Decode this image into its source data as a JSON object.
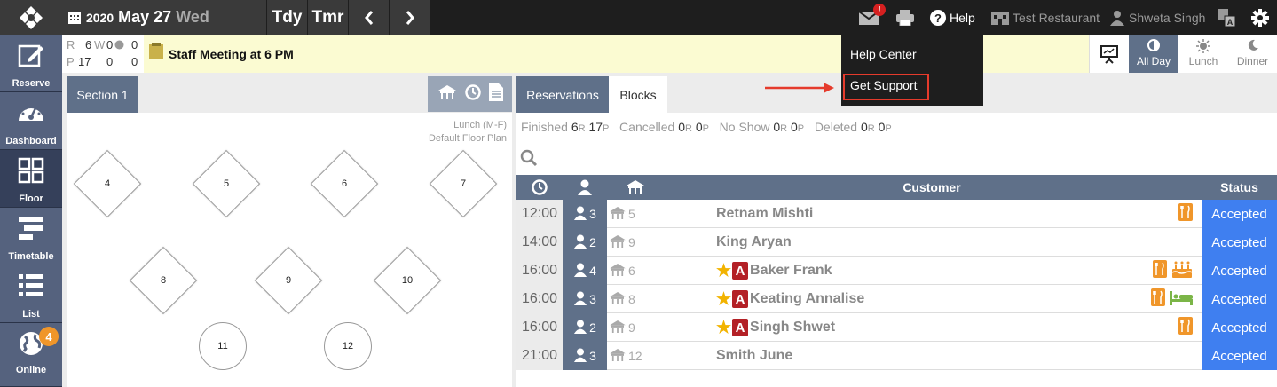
{
  "topbar": {
    "year": "2020",
    "month_day": "May 27",
    "weekday": "Wed",
    "today_label": "Tdy",
    "tomorrow_label": "Tmr",
    "mail_badge": "!",
    "help_label": "Help",
    "restaurant_name": "Test Restaurant",
    "user_name": "Shweta Singh"
  },
  "sidebar": {
    "items": [
      {
        "label": "Reserve"
      },
      {
        "label": "Dashboard"
      },
      {
        "label": "Floor"
      },
      {
        "label": "Timetable"
      },
      {
        "label": "List"
      },
      {
        "label": "Online",
        "badge": "4"
      }
    ]
  },
  "stats": {
    "r_label": "R",
    "r_val": "6",
    "w_label": "W",
    "w_val": "0",
    "o_val": "0",
    "p_label": "P",
    "p_val": "17",
    "p_w": "0",
    "p_o": "0"
  },
  "notice": {
    "text": "Staff Meeting at 6 PM"
  },
  "meals": {
    "all_day": "All Day",
    "lunch": "Lunch",
    "dinner": "Dinner"
  },
  "floor": {
    "section_tab": "Section 1",
    "plan_line1": "Lunch (M-F)",
    "plan_line2": "Default Floor Plan",
    "tables": [
      "4",
      "5",
      "6",
      "7",
      "8",
      "9",
      "10",
      "11",
      "12"
    ]
  },
  "tabs": {
    "reservations": "Reservations",
    "blocks": "Blocks"
  },
  "summary": {
    "finished_label": "Finished",
    "finished_r": "6",
    "finished_p": "17",
    "cancelled_label": "Cancelled",
    "cancelled_r": "0",
    "cancelled_p": "0",
    "noshow_label": "No Show",
    "noshow_r": "0",
    "noshow_p": "0",
    "deleted_label": "Deleted",
    "deleted_r": "0",
    "deleted_p": "0",
    "r_suffix": "R",
    "p_suffix": "P"
  },
  "table_header": {
    "customer": "Customer",
    "status": "Status"
  },
  "reservations": [
    {
      "time": "12:00",
      "party": "3",
      "table": "5",
      "customer": "Retnam Mishti",
      "vip": false,
      "tags": [
        "dining"
      ],
      "status": "Accepted"
    },
    {
      "time": "14:00",
      "party": "2",
      "table": "9",
      "customer": "King Aryan",
      "vip": false,
      "tags": [],
      "status": "Accepted"
    },
    {
      "time": "16:00",
      "party": "4",
      "table": "6",
      "customer": "Baker Frank",
      "vip": true,
      "tags": [
        "dining",
        "birthday"
      ],
      "status": "Accepted"
    },
    {
      "time": "16:00",
      "party": "3",
      "table": "8",
      "customer": "Keating Annalise",
      "vip": true,
      "tags": [
        "dining",
        "hotel"
      ],
      "status": "Accepted"
    },
    {
      "time": "16:00",
      "party": "2",
      "table": "9",
      "customer": "Singh Shwet",
      "vip": true,
      "tags": [
        "dining"
      ],
      "status": "Accepted"
    },
    {
      "time": "21:00",
      "party": "3",
      "table": "12",
      "customer": "Smith June",
      "vip": false,
      "tags": [],
      "status": "Accepted"
    }
  ],
  "vip_badge": "A",
  "help_menu": {
    "help_center": "Help Center",
    "get_support": "Get Support"
  },
  "colors": {
    "accent_blue": "#3f7ff0",
    "nav_slate": "#5f7089",
    "tag_orange": "#f0962a",
    "tag_green": "#7bb547",
    "highlight_red": "#e53b2c"
  }
}
